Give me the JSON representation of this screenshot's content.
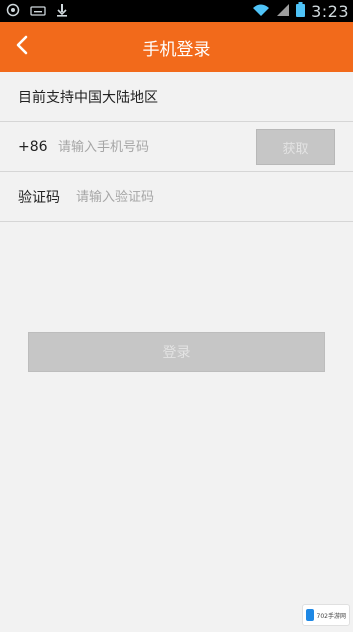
{
  "status_bar": {
    "time": "3:23",
    "icons": [
      "target-icon",
      "keyboard-icon",
      "download-icon",
      "wifi-icon",
      "signal-icon",
      "battery-icon"
    ]
  },
  "app_bar": {
    "title": "手机登录",
    "back_icon": "chevron-left-icon",
    "color": "#f26a1b"
  },
  "form": {
    "region_notice": "目前支持中国大陆地区",
    "country_code": "+86",
    "phone_placeholder": "请输入手机号码",
    "get_code_label": "获取",
    "code_label": "验证码",
    "code_placeholder": "请输入验证码"
  },
  "login_button": {
    "label": "登录"
  },
  "watermark": {
    "text": "702手游网"
  }
}
